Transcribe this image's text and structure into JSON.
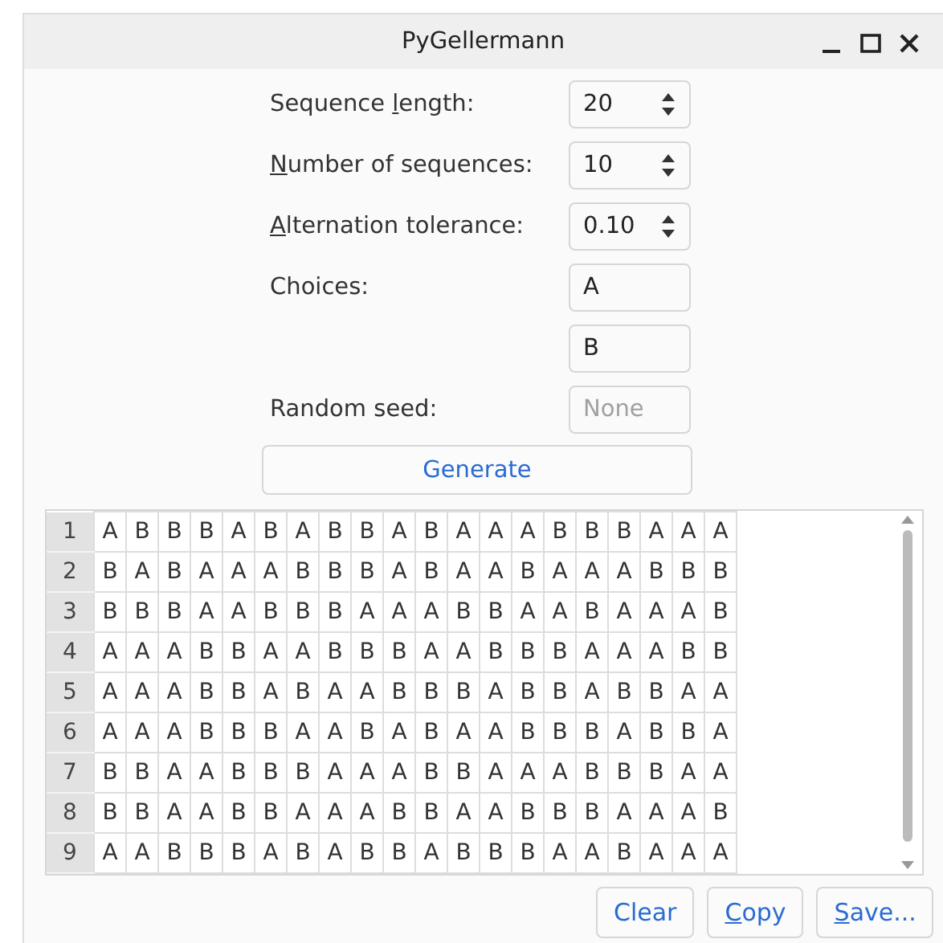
{
  "window": {
    "title": "PyGellermann",
    "controls": [
      {
        "kind": "minimize"
      },
      {
        "kind": "maximize"
      },
      {
        "kind": "close"
      }
    ]
  },
  "form": [
    {
      "label": [
        {
          "text": "Sequence ",
          "underline": false
        },
        {
          "text": "l",
          "underline": true
        },
        {
          "text": "ength:",
          "underline": false
        }
      ],
      "field": {
        "kind": "spin",
        "value": "20"
      }
    },
    {
      "label": [
        {
          "text": "N",
          "underline": true
        },
        {
          "text": "umber of sequences:",
          "underline": false
        }
      ],
      "field": {
        "kind": "spin",
        "value": "10"
      }
    },
    {
      "label": [
        {
          "text": "A",
          "underline": true
        },
        {
          "text": "lternation tolerance:",
          "underline": false
        }
      ],
      "field": {
        "kind": "spin",
        "value": "0.10"
      }
    },
    {
      "label": [
        {
          "text": "Choices:",
          "underline": false
        }
      ],
      "field": {
        "kind": "text",
        "value": "A"
      }
    },
    {
      "field": {
        "kind": "text",
        "value": "B"
      }
    },
    {
      "label": [
        {
          "text": "Random seed:",
          "underline": false
        }
      ],
      "field": {
        "kind": "text",
        "placeholder": "None"
      }
    }
  ],
  "generate_button": "Generate",
  "table": {
    "rows": [
      {
        "header": "1",
        "cells": [
          "A",
          "B",
          "B",
          "B",
          "A",
          "B",
          "A",
          "B",
          "B",
          "A",
          "B",
          "A",
          "A",
          "A",
          "B",
          "B",
          "B",
          "A",
          "A",
          "A"
        ]
      },
      {
        "header": "2",
        "cells": [
          "B",
          "A",
          "B",
          "A",
          "A",
          "A",
          "B",
          "B",
          "B",
          "A",
          "B",
          "A",
          "A",
          "B",
          "A",
          "A",
          "A",
          "B",
          "B",
          "B"
        ]
      },
      {
        "header": "3",
        "cells": [
          "B",
          "B",
          "B",
          "A",
          "A",
          "B",
          "B",
          "B",
          "A",
          "A",
          "A",
          "B",
          "B",
          "A",
          "A",
          "B",
          "A",
          "A",
          "A",
          "B"
        ]
      },
      {
        "header": "4",
        "cells": [
          "A",
          "A",
          "A",
          "B",
          "B",
          "A",
          "A",
          "B",
          "B",
          "B",
          "A",
          "A",
          "B",
          "B",
          "B",
          "A",
          "A",
          "A",
          "B",
          "B"
        ]
      },
      {
        "header": "5",
        "cells": [
          "A",
          "A",
          "A",
          "B",
          "B",
          "A",
          "B",
          "A",
          "A",
          "B",
          "B",
          "B",
          "A",
          "B",
          "B",
          "A",
          "B",
          "B",
          "A",
          "A"
        ]
      },
      {
        "header": "6",
        "cells": [
          "A",
          "A",
          "A",
          "B",
          "B",
          "B",
          "A",
          "A",
          "B",
          "A",
          "B",
          "A",
          "A",
          "B",
          "B",
          "B",
          "A",
          "B",
          "B",
          "A"
        ]
      },
      {
        "header": "7",
        "cells": [
          "B",
          "B",
          "A",
          "A",
          "B",
          "B",
          "B",
          "A",
          "A",
          "A",
          "B",
          "B",
          "A",
          "A",
          "A",
          "B",
          "B",
          "B",
          "A",
          "A"
        ]
      },
      {
        "header": "8",
        "cells": [
          "B",
          "B",
          "A",
          "A",
          "B",
          "B",
          "A",
          "A",
          "A",
          "B",
          "B",
          "A",
          "A",
          "B",
          "B",
          "B",
          "A",
          "A",
          "A",
          "B"
        ]
      },
      {
        "header": "9",
        "cells": [
          "A",
          "A",
          "B",
          "B",
          "B",
          "A",
          "B",
          "A",
          "B",
          "B",
          "A",
          "B",
          "B",
          "B",
          "A",
          "A",
          "B",
          "A",
          "A",
          "A"
        ]
      }
    ]
  },
  "buttons": [
    {
      "label": [
        {
          "text": "Clear",
          "underline": false
        }
      ]
    },
    {
      "label": [
        {
          "text": "C",
          "underline": true
        },
        {
          "text": "opy",
          "underline": false
        }
      ]
    },
    {
      "label": [
        {
          "text": "S",
          "underline": true
        },
        {
          "text": "ave...",
          "underline": false
        }
      ]
    }
  ]
}
